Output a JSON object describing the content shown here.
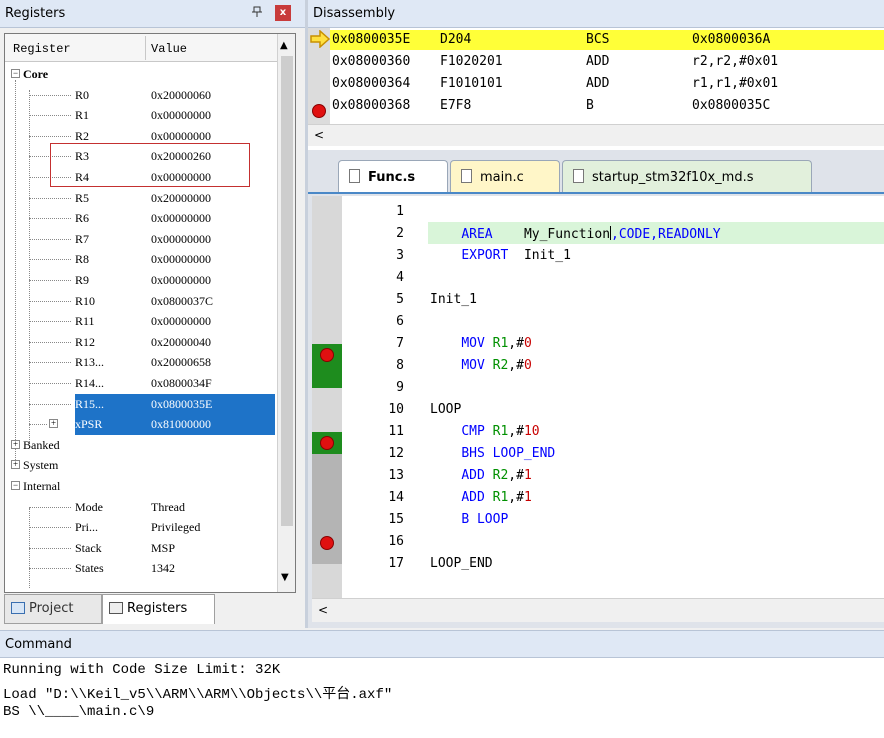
{
  "registers_panel": {
    "title": "Registers",
    "pin_glyph": "ɨ",
    "close_glyph": "x",
    "col_register": "Register",
    "col_value": "Value",
    "rows": [
      {
        "name": "Core",
        "value": ""
      },
      {
        "name": "R0",
        "value": "0x20000060"
      },
      {
        "name": "R1",
        "value": "0x00000000"
      },
      {
        "name": "R2",
        "value": "0x00000000"
      },
      {
        "name": "R3",
        "value": "0x20000260"
      },
      {
        "name": "R4",
        "value": "0x00000000"
      },
      {
        "name": "R5",
        "value": "0x20000000"
      },
      {
        "name": "R6",
        "value": "0x00000000"
      },
      {
        "name": "R7",
        "value": "0x00000000"
      },
      {
        "name": "R8",
        "value": "0x00000000"
      },
      {
        "name": "R9",
        "value": "0x00000000"
      },
      {
        "name": "R10",
        "value": "0x0800037C"
      },
      {
        "name": "R11",
        "value": "0x00000000"
      },
      {
        "name": "R12",
        "value": "0x20000040"
      },
      {
        "name": "R13...",
        "value": "0x20000658"
      },
      {
        "name": "R14...",
        "value": "0x0800034F"
      },
      {
        "name": "R15...",
        "value": "0x0800035E"
      },
      {
        "name": "xPSR",
        "value": "0x81000000"
      },
      {
        "name": "Banked",
        "value": ""
      },
      {
        "name": "System",
        "value": ""
      },
      {
        "name": "Internal",
        "value": ""
      },
      {
        "name": "Mode",
        "value": "Thread"
      },
      {
        "name": "Pri...",
        "value": "Privileged"
      },
      {
        "name": "Stack",
        "value": "MSP"
      },
      {
        "name": "States",
        "value": "1342"
      }
    ],
    "tab_project": "Project",
    "tab_registers": "Registers"
  },
  "disassembly": {
    "title": "Disassembly",
    "lines": [
      {
        "addr": "0x0800035E",
        "op": "D204",
        "mn": "BCS",
        "arg": "0x0800036A"
      },
      {
        "addr": "0x08000360",
        "op": "F1020201",
        "mn": "ADD",
        "arg": "r2,r2,#0x01"
      },
      {
        "addr": "0x08000364",
        "op": "F1010101",
        "mn": "ADD",
        "arg": "r1,r1,#0x01"
      },
      {
        "addr": "0x08000368",
        "op": "E7F8",
        "mn": "B",
        "arg": "0x0800035C"
      }
    ]
  },
  "editor": {
    "tabs": [
      {
        "label": "Func.s"
      },
      {
        "label": "main.c"
      },
      {
        "label": "startup_stm32f10x_md.s"
      }
    ],
    "line_numbers": [
      "1",
      "2",
      "3",
      "4",
      "5",
      "6",
      "7",
      "8",
      "9",
      "10",
      "11",
      "12",
      "13",
      "14",
      "15",
      "16",
      "17"
    ],
    "code": {
      "l2_kw": "AREA",
      "l2_name": "My_Function",
      "l2_rest": ",CODE,READONLY",
      "l3_kw": "EXPORT",
      "l3_name": "Init_1",
      "l5": "Init_1",
      "l7_kw": "MOV",
      "l7_reg": "R1",
      "l7_sep": ",#",
      "l7_num": "0",
      "l8_kw": "MOV",
      "l8_reg": "R2",
      "l8_sep": ",#",
      "l8_num": "0",
      "l10": "LOOP",
      "l11_kw": "CMP",
      "l11_reg": "R1",
      "l11_sep": ",#",
      "l11_num": "10",
      "l12_kw": "BHS",
      "l12_name": "LOOP_END",
      "l13_kw": "ADD",
      "l13_reg": "R2",
      "l13_sep": ",#",
      "l13_num": "1",
      "l14_kw": "ADD",
      "l14_reg": "R1",
      "l14_sep": ",#",
      "l14_num": "1",
      "l15_kw": "B",
      "l15_name": "LOOP",
      "l17": "LOOP_END"
    }
  },
  "command": {
    "title": "Command",
    "lines": [
      "Running with Code Size Limit: 32K",
      "Load \"D:\\\\Keil_v5\\\\ARM\\\\ARM\\\\Objects\\\\平台.axf\"",
      "BS \\\\____\\main.c\\9"
    ]
  },
  "colors": {
    "current_line": "#ffff38",
    "breakpoint": "#e01010",
    "selection": "#1e73c8",
    "executed_block": "#1e8c1e"
  }
}
